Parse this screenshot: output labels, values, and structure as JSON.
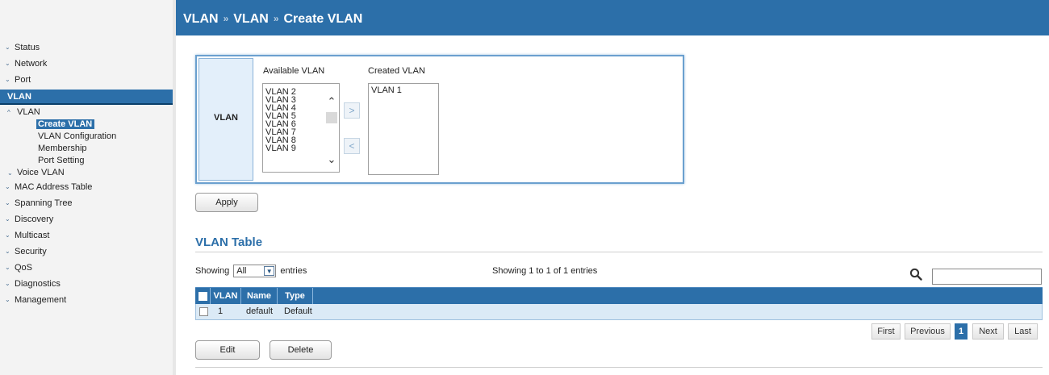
{
  "header": {
    "breadcrumb": [
      "VLAN",
      "VLAN",
      "Create VLAN"
    ],
    "separator": "»"
  },
  "sidebar": {
    "items_before": [
      {
        "label": "Status"
      },
      {
        "label": "Network"
      },
      {
        "label": "Port"
      }
    ],
    "active_section": "VLAN",
    "vlan_group": {
      "label": "VLAN",
      "children": [
        "Create VLAN",
        "VLAN Configuration",
        "Membership",
        "Port Setting"
      ],
      "current": "Create VLAN"
    },
    "voice_vlan": "Voice VLAN",
    "items_after": [
      {
        "label": "MAC Address Table"
      },
      {
        "label": "Spanning Tree"
      },
      {
        "label": "Discovery"
      },
      {
        "label": "Multicast"
      },
      {
        "label": "Security"
      },
      {
        "label": "QoS"
      },
      {
        "label": "Diagnostics"
      },
      {
        "label": "Management"
      }
    ]
  },
  "vlan_form": {
    "row_label": "VLAN",
    "available_heading": "Available VLAN",
    "created_heading": "Created VLAN",
    "available": [
      "VLAN 2",
      "VLAN 3",
      "VLAN 4",
      "VLAN 5",
      "VLAN 6",
      "VLAN 7",
      "VLAN 8",
      "VLAN 9"
    ],
    "created": [
      "VLAN 1"
    ],
    "add_glyph": ">",
    "remove_glyph": "<",
    "apply_label": "Apply"
  },
  "vlan_table": {
    "title": "VLAN Table",
    "showing_prefix": "Showing",
    "entries_option": "All",
    "showing_suffix": "entries",
    "info": "Showing 1 to 1 of 1 entries",
    "search_value": "",
    "columns": [
      "VLAN",
      "Name",
      "Type"
    ],
    "rows": [
      {
        "vlan": "1",
        "name": "default",
        "type": "Default"
      }
    ],
    "pager": {
      "first": "First",
      "previous": "Previous",
      "current": "1",
      "next": "Next",
      "last": "Last"
    },
    "edit_label": "Edit",
    "delete_label": "Delete"
  },
  "colors": {
    "accent": "#2c6fa9",
    "row_highlight": "#dbeaf6",
    "panel_border": "#6ba0cf"
  }
}
